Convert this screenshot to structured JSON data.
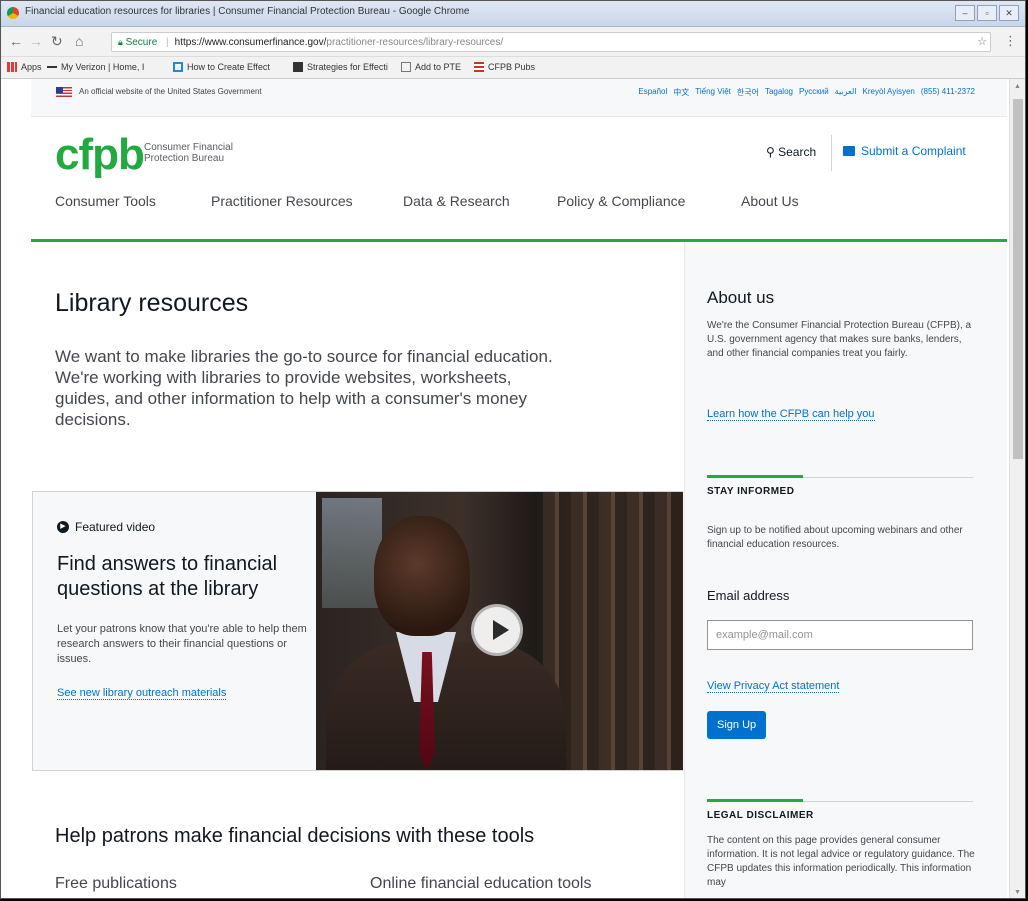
{
  "browser": {
    "window_title": "Financial education resources for libraries | Consumer Financial Protection Bureau - Google Chrome",
    "secure_label": "Secure",
    "url_host": "https://www.consumerfinance.gov/",
    "url_path": "practitioner-resources/library-resources/",
    "bookmarks": [
      {
        "label": "Apps"
      },
      {
        "label": "My Verizon | Home, I"
      },
      {
        "label": "How to Create Effect"
      },
      {
        "label": "Strategies for Effecti"
      },
      {
        "label": "Add to PTE"
      },
      {
        "label": "CFPB Pubs"
      }
    ]
  },
  "govbar": {
    "official": "An official website of the United States Government",
    "languages": [
      "Español",
      "中文",
      "Tiếng Việt",
      "한국어",
      "Tagalog",
      "Русский",
      "العربية",
      "Kreyòl Ayisyen"
    ],
    "phone": "(855) 411-2372"
  },
  "header": {
    "logo": "cfpb",
    "logo_line1": "Consumer Financial",
    "logo_line2": "Protection Bureau",
    "search_label": "Search",
    "complaint_label": "Submit a Complaint"
  },
  "nav": {
    "items": [
      "Consumer Tools",
      "Practitioner Resources",
      "Data & Research",
      "Policy & Compliance",
      "About Us"
    ]
  },
  "main": {
    "title": "Library resources",
    "lead": "We want to make libraries the go-to source for financial education. We're working with libraries to provide websites, worksheets, guides, and other information to help with a consumer's money decisions.",
    "featured": {
      "label": "Featured video",
      "title": "Find answers to financial questions at the library",
      "body": "Let your patrons know that you're able to help them research answers to their financial questions or issues.",
      "link": "See new library outreach materials"
    },
    "help_title": "Help patrons make financial decisions with these tools",
    "col_free": "Free publications",
    "col_online": "Online financial education tools"
  },
  "sidebar": {
    "about_title": "About us",
    "about_body": "We're the Consumer Financial Protection Bureau (CFPB), a U.S. government agency that makes sure banks, lenders, and other financial companies treat you fairly.",
    "about_link": "Learn how the CFPB can help you",
    "stay_label": "STAY INFORMED",
    "stay_body": "Sign up to be notified about upcoming webinars and other financial education resources.",
    "email_label": "Email address",
    "email_placeholder": "example@mail.com",
    "privacy_link": "View Privacy Act statement",
    "signup_button": "Sign Up",
    "legal_label": "LEGAL DISCLAIMER",
    "legal_body": "The content on this page provides general consumer information. It is not legal advice or regulatory guidance. The CFPB updates this information periodically. This information may"
  },
  "colors": {
    "brand_green": "#20aa3f",
    "link_blue": "#0072ce"
  }
}
